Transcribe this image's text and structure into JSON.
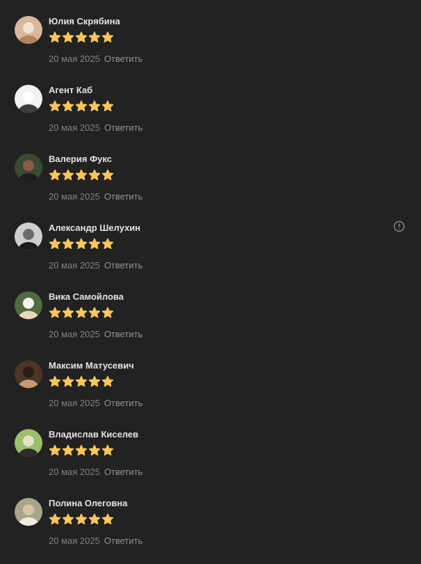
{
  "rating_max": 5,
  "colors": {
    "background": "#222222",
    "star": "#ffc65c",
    "author": "#e1e3e6",
    "meta": "#828282"
  },
  "reviews": [
    {
      "author": "Юлия Скрябина",
      "rating": 5,
      "date": "20 мая 2025",
      "reply_label": "Ответить",
      "avatar_colors": [
        "#d8b79c",
        "#b08460",
        "#efe3d4"
      ],
      "report_icon": false
    },
    {
      "author": "Агент Каб",
      "rating": 5,
      "date": "20 мая 2025",
      "reply_label": "Ответить",
      "avatar_colors": [
        "#f2f2f2",
        "#3c3c3c",
        "#ffffff"
      ],
      "report_icon": false
    },
    {
      "author": "Валерия Фукс",
      "rating": 5,
      "date": "20 мая 2025",
      "reply_label": "Ответить",
      "avatar_colors": [
        "#3b4a32",
        "#1d1d1d",
        "#8a5a4a"
      ],
      "report_icon": false
    },
    {
      "author": "Александр Шелухин",
      "rating": 5,
      "date": "20 мая 2025",
      "reply_label": "Ответить",
      "avatar_colors": [
        "#cfcfcf",
        "#1c1c1c",
        "#6b6b6b"
      ],
      "report_icon": true,
      "report_icon_name": "exclamation-circle-icon"
    },
    {
      "author": "Вика Самойлова",
      "rating": 5,
      "date": "20 мая 2025",
      "reply_label": "Ответить",
      "avatar_colors": [
        "#4f6b3f",
        "#e8d9b8",
        "#f5f5f5"
      ],
      "report_icon": false
    },
    {
      "author": "Максим Матусевич",
      "rating": 5,
      "date": "20 мая 2025",
      "reply_label": "Ответить",
      "avatar_colors": [
        "#4a3526",
        "#c79a73",
        "#2a1d14"
      ],
      "report_icon": false
    },
    {
      "author": "Владислав Киселев",
      "rating": 5,
      "date": "20 мая 2025",
      "reply_label": "Ответить",
      "avatar_colors": [
        "#9bbf6a",
        "#2c2c2c",
        "#e7e0c9"
      ],
      "report_icon": false
    },
    {
      "author": "Полина Олеговна",
      "rating": 5,
      "date": "20 мая 2025",
      "reply_label": "Ответить",
      "avatar_colors": [
        "#a9a58a",
        "#f1ece1",
        "#d6c2a6"
      ],
      "report_icon": false
    }
  ]
}
